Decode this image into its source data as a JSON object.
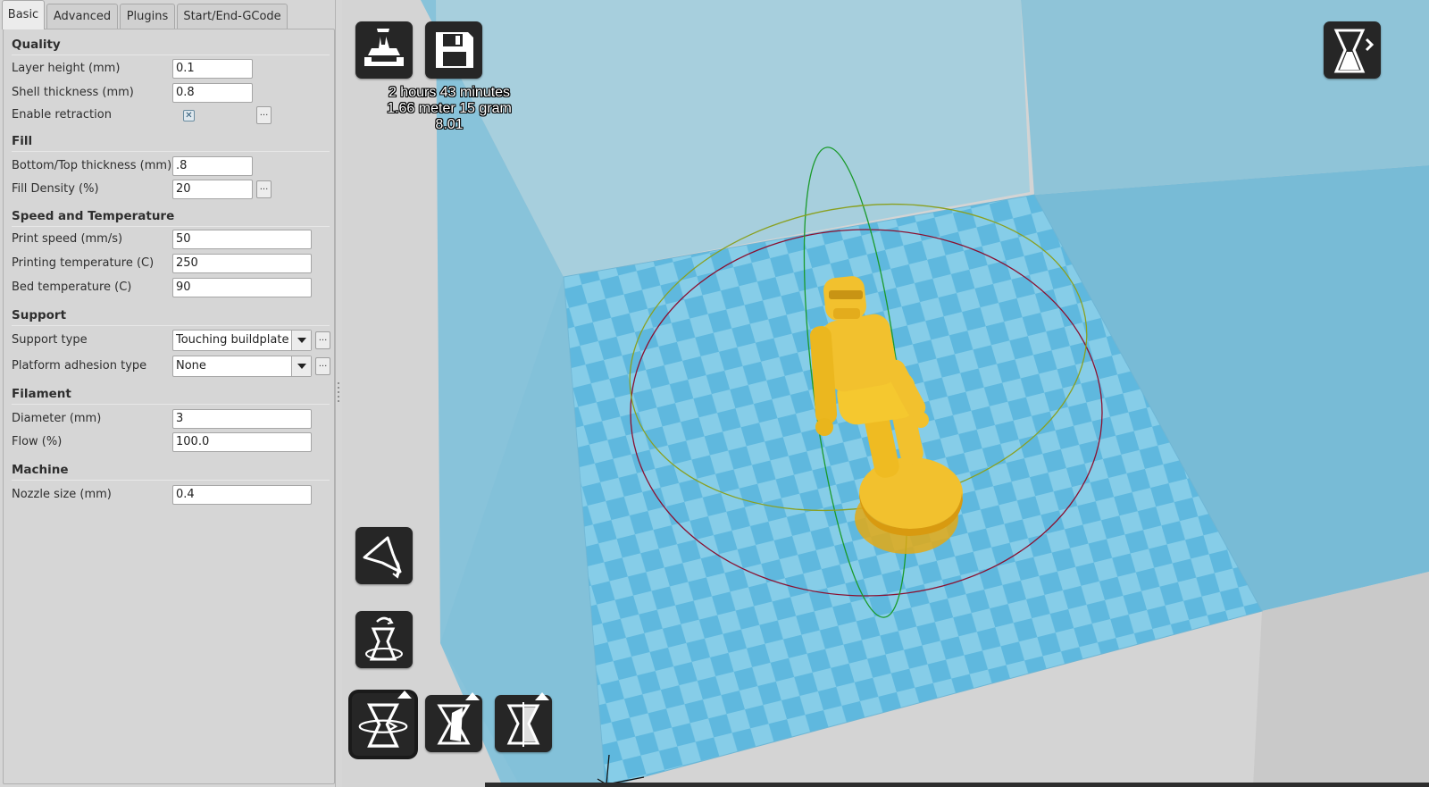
{
  "tabs": [
    {
      "label": "Basic"
    },
    {
      "label": "Advanced"
    },
    {
      "label": "Plugins"
    },
    {
      "label": "Start/End-GCode"
    }
  ],
  "sections": {
    "quality": {
      "title": "Quality",
      "layer_height": {
        "label": "Layer height (mm)",
        "value": "0.1"
      },
      "shell_thickness": {
        "label": "Shell thickness (mm)",
        "value": "0.8"
      },
      "enable_retraction": {
        "label": "Enable retraction",
        "checked": true,
        "more": "..."
      }
    },
    "fill": {
      "title": "Fill",
      "bottom_top_thickness": {
        "label": "Bottom/Top thickness (mm)",
        "value": ".8"
      },
      "fill_density": {
        "label": "Fill Density (%)",
        "value": "20",
        "more": "..."
      }
    },
    "speed_temperature": {
      "title": "Speed and Temperature",
      "print_speed": {
        "label": "Print speed (mm/s)",
        "value": "50"
      },
      "printing_temperature": {
        "label": "Printing temperature (C)",
        "value": "250"
      },
      "bed_temperature": {
        "label": "Bed temperature (C)",
        "value": "90"
      }
    },
    "support": {
      "title": "Support",
      "support_type": {
        "label": "Support type",
        "value": "Touching buildplate",
        "more": "..."
      },
      "platform_adhesion": {
        "label": "Platform adhesion type",
        "value": "None",
        "more": "..."
      }
    },
    "filament": {
      "title": "Filament",
      "diameter": {
        "label": "Diameter (mm)",
        "value": "3"
      },
      "flow": {
        "label": "Flow (%)",
        "value": "100.0"
      }
    },
    "machine": {
      "title": "Machine",
      "nozzle_size": {
        "label": "Nozzle size (mm)",
        "value": "0.4"
      }
    }
  },
  "viewport": {
    "print_info": {
      "time": "2 hours 43 minutes",
      "material": "1.66 meter 15 gram",
      "cost": "8.01"
    },
    "toolbar_icons": {
      "load": "load-model-icon",
      "save": "save-gcode-icon",
      "view_mode": "view-mode-icon",
      "rotate": "rotate-tool-icon",
      "lay_flat": "lay-flat-icon",
      "scale": "scale-tool-icon",
      "mirror": "mirror-tool-icon",
      "reset": "reset-rotation-icon"
    },
    "colors": {
      "build_volume": "#7ec6dc",
      "bed_checker_a": "#5fb8de",
      "bed_checker_b": "#86cde8",
      "model": "#f2c12e",
      "ring_red": "#8a1030",
      "ring_green": "#1a9a2a",
      "ring_olive": "#8aa020",
      "toolbar_bg": "#262626"
    }
  }
}
